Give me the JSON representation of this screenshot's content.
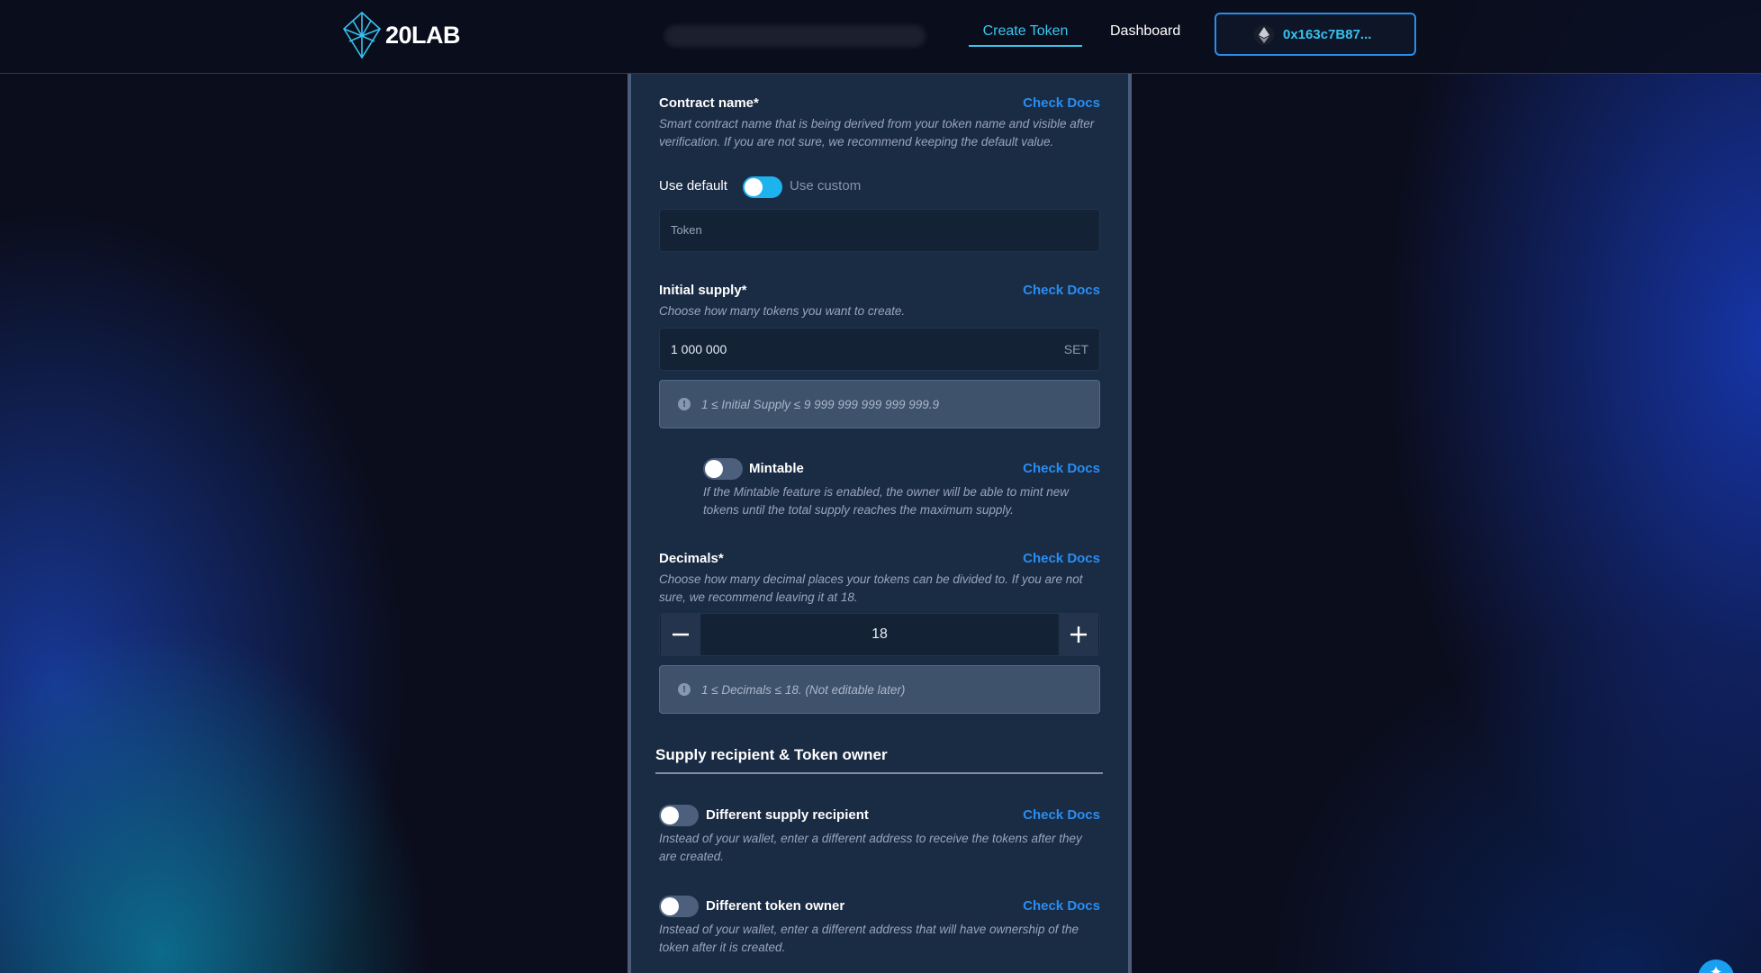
{
  "header": {
    "logo_text": "20LAB",
    "nav": {
      "create_token": "Create Token",
      "dashboard": "Dashboard"
    },
    "wallet_address": "0x163c7B87..."
  },
  "form": {
    "contract_name": {
      "label": "Contract name*",
      "docs": "Check Docs",
      "description": "Smart contract name that is being derived from your token name and visible after verification. If you are not sure, we recommend keeping the default value.",
      "use_default": "Use default",
      "use_custom": "Use custom",
      "toggle_state": "default",
      "placeholder": "Token"
    },
    "initial_supply": {
      "label": "Initial supply*",
      "docs": "Check Docs",
      "description": "Choose how many tokens you want to create.",
      "value": "1 000 000",
      "unit": "SET",
      "info": "1 ≤ Initial Supply ≤ 9 999 999 999 999 999.9"
    },
    "mintable": {
      "label": "Mintable",
      "docs": "Check Docs",
      "description": "If the Mintable feature is enabled, the owner will be able to mint new tokens until the total supply reaches the maximum supply.",
      "enabled": false
    },
    "decimals": {
      "label": "Decimals*",
      "docs": "Check Docs",
      "description": "Choose how many decimal places your tokens can be divided to. If you are not sure, we recommend leaving it at 18.",
      "value": "18",
      "info": "1 ≤ Decimals ≤ 18. (Not editable later)"
    },
    "supply_section": {
      "title": "Supply recipient & Token owner",
      "different_recipient": {
        "label": "Different supply recipient",
        "docs": "Check Docs",
        "description": "Instead of your wallet, enter a different address to receive the tokens after they are created.",
        "enabled": false
      },
      "different_owner": {
        "label": "Different token owner",
        "docs": "Check Docs",
        "description": "Instead of your wallet, enter a different address that will have ownership of the token after it is created.",
        "enabled": false
      }
    }
  },
  "colors": {
    "accent": "#38c7ef",
    "link": "#2a8df0",
    "panel": "#1a2b44",
    "toggle_on": "#1db3ef"
  }
}
